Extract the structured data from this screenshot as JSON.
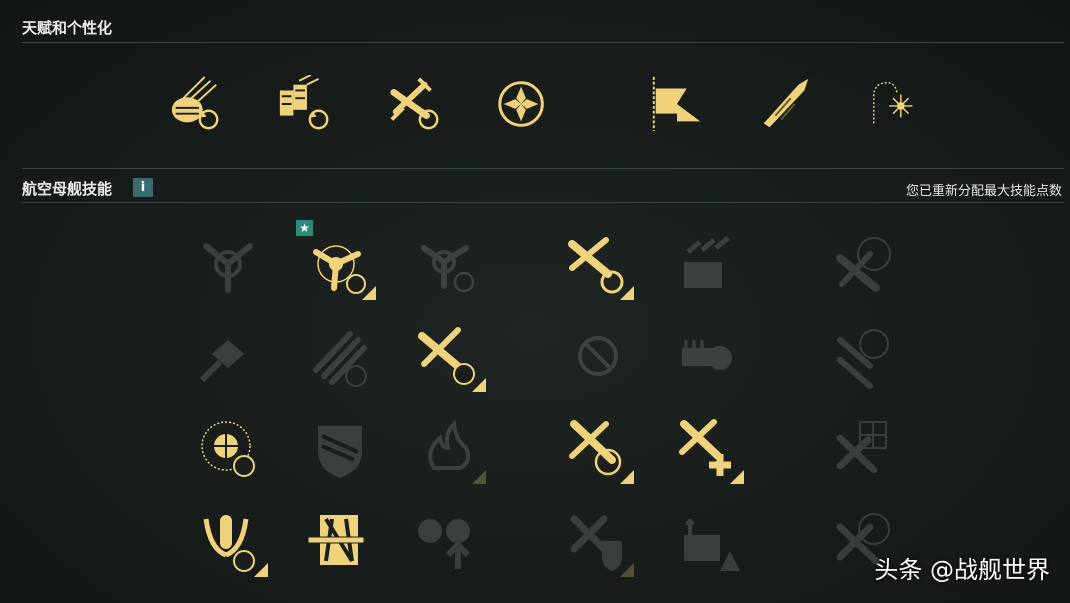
{
  "sections": {
    "talents_title": "天赋和个性化",
    "skills_title": "航空母舰技能",
    "info_label": "i",
    "reset_info": "您已重新分配最大技能点数"
  },
  "colors": {
    "gold": "#efd27a",
    "dim": "#8e9592",
    "accent_badge": "#2e8a7a"
  },
  "talents": [
    {
      "icon": "ap-shells-reload-icon"
    },
    {
      "icon": "torpedo-reload-icon"
    },
    {
      "icon": "aircraft-reload-icon"
    },
    {
      "icon": "cross-emblem-icon"
    },
    {
      "icon": "flag-icon"
    },
    {
      "icon": "camouflage-icon"
    },
    {
      "icon": "fireworks-icon"
    }
  ],
  "skills": [
    {
      "icon": "propeller-icon",
      "state": "inactive"
    },
    {
      "icon": "propeller-speed-icon",
      "state": "active",
      "starred": true
    },
    {
      "icon": "propeller-reload-icon",
      "state": "inactive"
    },
    {
      "icon": "aircraft-reload-icon",
      "state": "active"
    },
    {
      "icon": "carrier-aircraft-icon",
      "state": "inactive"
    },
    {
      "icon": "aircraft-target-icon",
      "state": "inactive"
    },
    {
      "icon": "aircraft-diamond-icon",
      "state": "inactive"
    },
    {
      "icon": "rockets-speed-icon",
      "state": "inactive"
    },
    {
      "icon": "aircraft-speed-icon",
      "state": "active"
    },
    {
      "icon": "no-entry-icon",
      "state": "inactive"
    },
    {
      "icon": "ship-guns-icon",
      "state": "inactive"
    },
    {
      "icon": "aircraft-target-double-icon",
      "state": "inactive"
    },
    {
      "icon": "crosshair-timer-icon",
      "state": "active"
    },
    {
      "icon": "shield-icon",
      "state": "inactive"
    },
    {
      "icon": "fire-icon",
      "state": "inactive"
    },
    {
      "icon": "aircraft-crosshair-icon",
      "state": "active"
    },
    {
      "icon": "aircraft-heal-icon",
      "state": "active"
    },
    {
      "icon": "aircraft-grid-icon",
      "state": "inactive"
    },
    {
      "icon": "bomb-wings-icon",
      "state": "active"
    },
    {
      "icon": "armor-torpedo-icon",
      "state": "active"
    },
    {
      "icon": "ammo-upgrade-icon",
      "state": "inactive"
    },
    {
      "icon": "aircraft-shield-icon",
      "state": "inactive"
    },
    {
      "icon": "carrier-warning-icon",
      "state": "inactive"
    },
    {
      "icon": "aircraft-target-dim-icon",
      "state": "inactive"
    }
  ],
  "watermark": "头条 @战舰世界"
}
